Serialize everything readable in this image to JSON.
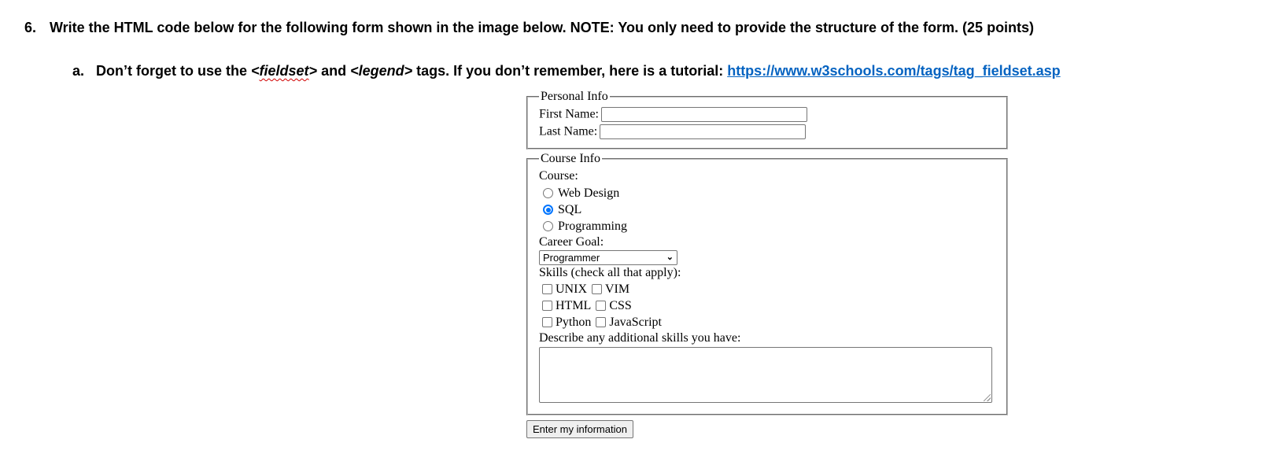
{
  "question": {
    "number": "6.",
    "text": "Write the HTML code below for the following form shown in the image below. NOTE: You only need to provide the structure of the form. (25 points)"
  },
  "sub_item": {
    "letter": "a.",
    "text_before": "Don’t forget to use the ",
    "tag1": "<fieldset>",
    "text_mid": " and ",
    "tag2": "<legend>",
    "text_after": " tags. If you don’t remember, here is a tutorial: ",
    "link_text": "https://www.w3schools.com/tags/tag_fieldset.asp",
    "link_color": "#0563c1"
  },
  "form": {
    "personal": {
      "legend": "Personal Info",
      "first_name_label": "First Name:",
      "first_name_value": "",
      "last_name_label": "Last Name:",
      "last_name_value": ""
    },
    "course_info": {
      "legend": "Course Info",
      "course_label": "Course:",
      "courses": [
        {
          "label": "Web Design",
          "checked": false
        },
        {
          "label": "SQL",
          "checked": true
        },
        {
          "label": "Programming",
          "checked": false
        }
      ],
      "career_label": "Career Goal:",
      "career_selected": "Programmer",
      "skills_label": "Skills (check all that apply):",
      "skills": [
        {
          "label": "UNIX",
          "checked": false
        },
        {
          "label": "VIM",
          "checked": false
        },
        {
          "label": "HTML",
          "checked": false
        },
        {
          "label": "CSS",
          "checked": false
        },
        {
          "label": "Python",
          "checked": false
        },
        {
          "label": "JavaScript",
          "checked": false
        }
      ],
      "describe_label": "Describe any additional skills you have:",
      "describe_value": ""
    },
    "submit_label": "Enter my information",
    "accent_color": "#0075ff"
  }
}
